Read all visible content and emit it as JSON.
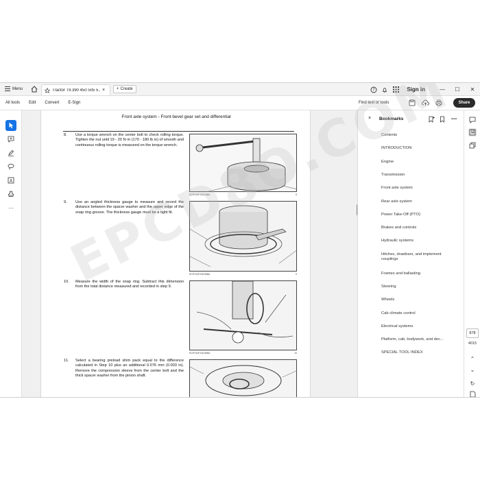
{
  "titlebar": {
    "menu_label": "Menu",
    "tab_title": "Tractor T9.390 450 505 5...",
    "create_label": "Create",
    "sign_in_label": "Sign in"
  },
  "toolbar": {
    "items": [
      "All tools",
      "Edit",
      "Convert",
      "E-Sign"
    ],
    "find_label": "Find text or tools",
    "share_label": "Share"
  },
  "document": {
    "header": "Front axle system - Front bevel gear set and differential",
    "steps": [
      {
        "num": "8.",
        "text": "Use a torque wrench on the center bolt to check rolling torque. Tighten the nut until 19 - 20 N·m (170 - 180 lb in) of smooth and continuous rolling torque is measured on the torque wrench.",
        "caption": "RCPH13FXD234BA",
        "fig_no": "8"
      },
      {
        "num": "9.",
        "text": "Use an angled thickness gauge to measure and record the distance between the spacer washer and the upper edge of the snap ring groove. The thickness gauge must be a tight fit.",
        "caption": "RCPH13FXD235BA",
        "fig_no": "9"
      },
      {
        "num": "10.",
        "text": "Measure the width of the snap ring. Subtract this dimension from the total distance measured and recorded in step 9.",
        "caption": "RCPH13FXD236BA",
        "fig_no": "10"
      },
      {
        "num": "11.",
        "text": "Select a bearing preload shim pack equal to the difference calculated in Step 10 plus an additional 0.076 mm (0.003 in). Remove the compression sleeve from the center bolt and the thick spacer washer from the pinion shaft.",
        "caption": "",
        "fig_no": ""
      }
    ]
  },
  "bookmarks": {
    "title": "Bookmarks",
    "items": [
      "Contents",
      "INTRODUCTION",
      "Engine",
      "Transmission",
      "Front axle system",
      "Rear axle system",
      "Power Take-Off (PTO)",
      "Brakes and controls",
      "Hydraulic systems",
      "Hitches, drawbars, and implement couplings",
      "Frames and ballasting",
      "Steering",
      "Wheels",
      "Cab climate control",
      "Electrical systems",
      "Platform, cab, bodywork, and dec...",
      "SPECIAL TOOL INDEX"
    ]
  },
  "pager": {
    "current": "878",
    "total": "4015"
  },
  "colors": {
    "accent": "#1473e6",
    "share_bg": "#2a2a2a"
  }
}
